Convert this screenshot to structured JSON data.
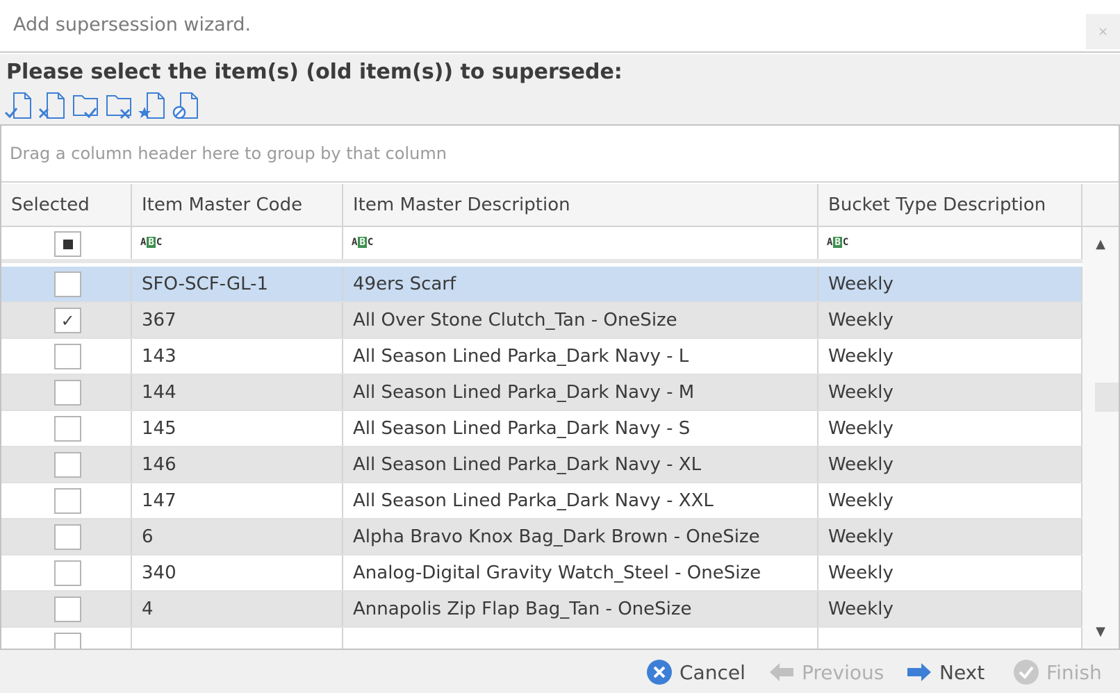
{
  "window": {
    "title": "Add supersession wizard.",
    "close_label": "×"
  },
  "header": {
    "prompt": "Please select the item(s) (old item(s)) to supersede:",
    "toolbar_icons": [
      "select-all-icon",
      "deselect-all-icon",
      "select-filtered-icon",
      "deselect-filtered-icon",
      "select-starred-icon",
      "clear-selection-icon"
    ]
  },
  "grid": {
    "group_panel_text": "Drag a column header here to group by that column",
    "columns": [
      "Selected",
      "Item Master Code",
      "Item Master Description",
      "Bucket Type Description"
    ],
    "rows": [
      {
        "selected": false,
        "code": "SFO-SCF-GL-1",
        "description": "49ers Scarf",
        "bucket": "Weekly",
        "focused": true
      },
      {
        "selected": true,
        "code": "367",
        "description": "All Over Stone Clutch_Tan - OneSize",
        "bucket": "Weekly"
      },
      {
        "selected": false,
        "code": "143",
        "description": "All Season Lined Parka_Dark Navy - L",
        "bucket": "Weekly"
      },
      {
        "selected": false,
        "code": "144",
        "description": "All Season Lined Parka_Dark Navy - M",
        "bucket": "Weekly"
      },
      {
        "selected": false,
        "code": "145",
        "description": "All Season Lined Parka_Dark Navy - S",
        "bucket": "Weekly"
      },
      {
        "selected": false,
        "code": "146",
        "description": "All Season Lined Parka_Dark Navy - XL",
        "bucket": "Weekly"
      },
      {
        "selected": false,
        "code": "147",
        "description": "All Season Lined Parka_Dark Navy - XXL",
        "bucket": "Weekly"
      },
      {
        "selected": false,
        "code": "6",
        "description": "Alpha Bravo Knox Bag_Dark Brown - OneSize",
        "bucket": "Weekly"
      },
      {
        "selected": false,
        "code": "340",
        "description": "Analog-Digital Gravity Watch_Steel - OneSize",
        "bucket": "Weekly"
      },
      {
        "selected": false,
        "code": "4",
        "description": "Annapolis Zip Flap Bag_Tan - OneSize",
        "bucket": "Weekly"
      }
    ]
  },
  "footer": {
    "cancel": "Cancel",
    "previous": "Previous",
    "next": "Next",
    "finish": "Finish"
  },
  "colors": {
    "accent_blue": "#3d7fd6",
    "selected_row": "#c9dcf2",
    "alt_row": "#e4e4e4",
    "filter_icon_green": "#3f8f4f"
  }
}
